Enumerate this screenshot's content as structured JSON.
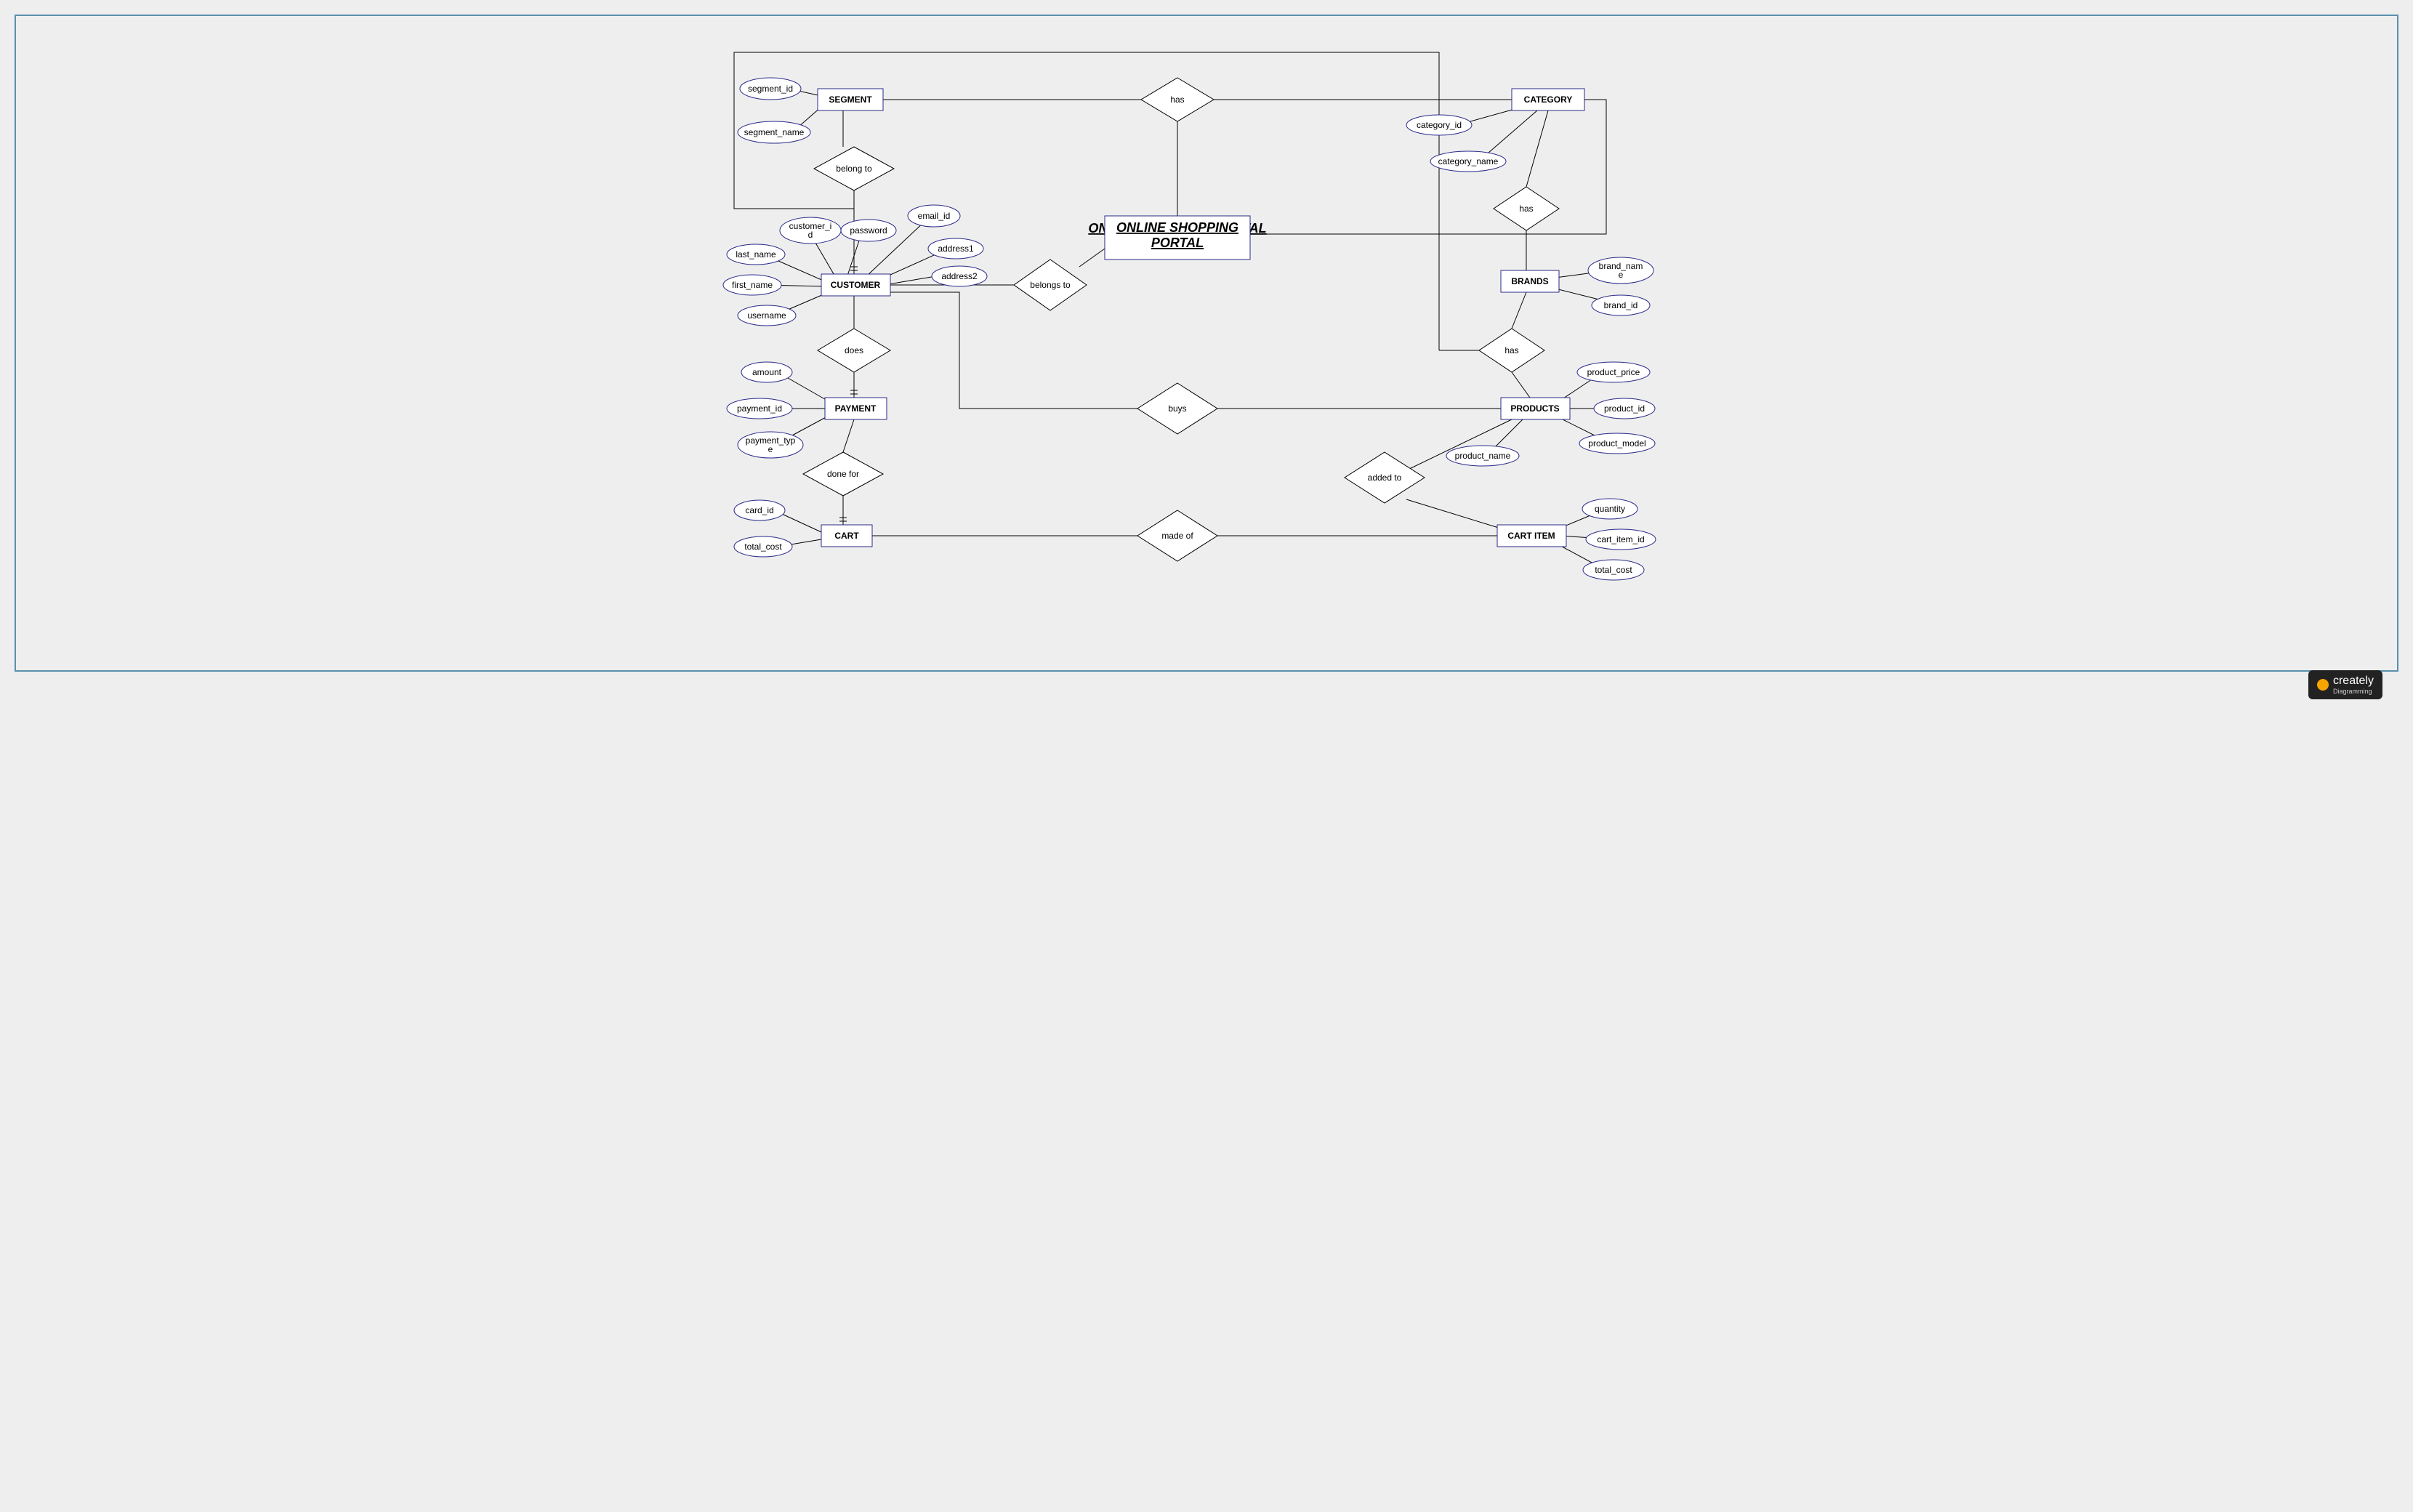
{
  "title": "ONLINE SHOPPING PORTAL",
  "logo": {
    "brand": "creately",
    "sub": "Diagramming"
  },
  "entities": {
    "segment": {
      "label": "SEGMENT",
      "attrs": [
        "segment_id",
        "segment_name"
      ]
    },
    "customer": {
      "label": "CUSTOMER",
      "attrs": [
        "customer_id",
        "password",
        "email_id",
        "address1",
        "address2",
        "last_name",
        "first_name",
        "username"
      ]
    },
    "payment": {
      "label": "PAYMENT",
      "attrs": [
        "amount",
        "payment_id",
        "payment_type"
      ]
    },
    "cart": {
      "label": "CART",
      "attrs": [
        "card_id",
        "total_cost"
      ]
    },
    "category": {
      "label": "CATEGORY",
      "attrs": [
        "category_id",
        "category_name"
      ]
    },
    "brands": {
      "label": "BRANDS",
      "attrs": [
        "brand_name",
        "brand_id"
      ]
    },
    "products": {
      "label": "PRODUCTS",
      "attrs": [
        "product_price",
        "product_id",
        "product_model",
        "product_name"
      ]
    },
    "cartitem": {
      "label": "CART ITEM",
      "attrs": [
        "quantity",
        "cart_item_id",
        "total_cost"
      ]
    }
  },
  "relationships": {
    "has1": "has",
    "belong_to": "belong to",
    "belongs_to": "belongs to",
    "does": "does",
    "done_for": "done for",
    "made_of": "made of",
    "buys": "buys",
    "added_to": "added to",
    "has2": "has",
    "has3": "has"
  }
}
